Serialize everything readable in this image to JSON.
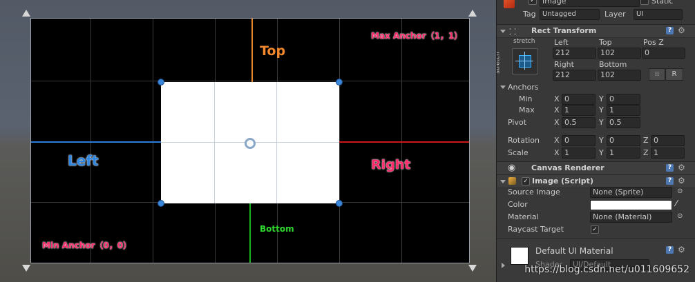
{
  "scene": {
    "labels": {
      "top": "Top",
      "left": "Left",
      "right": "Right",
      "bottom": "Bottom",
      "max_anchor": "Max Anchor（1，1）",
      "min_anchor": "Min Anchor（0，0）"
    },
    "colors": {
      "top_line": "#e0852c",
      "left_line": "#2d7ddb",
      "right_line": "#cc1818",
      "bottom_line": "#19b419",
      "top_label": "#f2872b",
      "left_label": "#2f86e0",
      "right_label": "#ff2a6a",
      "bottom_label": "#2ed82e",
      "anchor_label": "#ff2a6a"
    }
  },
  "inspector": {
    "gameobject": {
      "name": "Image",
      "static_label": "Static",
      "tag_label": "Tag",
      "tag_value": "Untagged",
      "layer_label": "Layer",
      "layer_value": "UI"
    },
    "rect_transform": {
      "title": "Rect Transform",
      "preset_label": "stretch",
      "preset_side_label": "stretch",
      "headers": {
        "left": "Left",
        "top": "Top",
        "posz": "Pos Z",
        "right": "Right",
        "bottom": "Bottom"
      },
      "values": {
        "left": "212",
        "top": "102",
        "posz": "0",
        "right": "212",
        "bottom": "102"
      },
      "raw_button": "R",
      "anchors_label": "Anchors",
      "min_label": "Min",
      "max_label": "Max",
      "min": {
        "x": "0",
        "y": "0"
      },
      "max": {
        "x": "1",
        "y": "1"
      },
      "pivot_label": "Pivot",
      "pivot": {
        "x": "0.5",
        "y": "0.5"
      },
      "rotation_label": "Rotation",
      "rotation": {
        "x": "0",
        "y": "0",
        "z": "0"
      },
      "scale_label": "Scale",
      "scale": {
        "x": "1",
        "y": "1",
        "z": "1"
      },
      "axis": {
        "x": "X",
        "y": "Y",
        "z": "Z"
      }
    },
    "canvas_renderer": {
      "title": "Canvas Renderer"
    },
    "image_script": {
      "title": "Image (Script)",
      "source_image_label": "Source Image",
      "source_image_value": "None (Sprite)",
      "color_label": "Color",
      "color_value": "#ffffff",
      "material_label": "Material",
      "material_value": "None (Material)",
      "raycast_label": "Raycast Target",
      "raycast_checked": "✓"
    },
    "material_preview": {
      "title": "Default UI Material",
      "shader_label": "Shader",
      "shader_value": "UI/Default"
    },
    "icons": {
      "help": "?",
      "gear": "⚙",
      "check": "✓",
      "eye": "◉",
      "pick": "⊙"
    }
  },
  "watermark": "https://blog.csdn.net/u011609652"
}
